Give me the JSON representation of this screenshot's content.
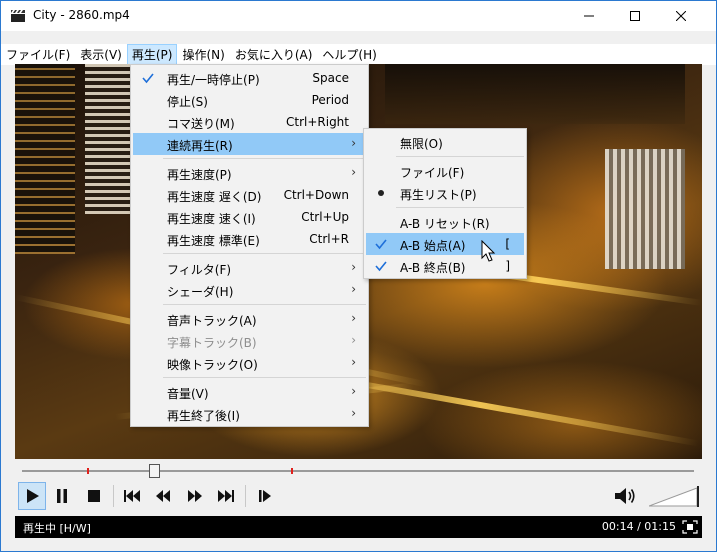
{
  "window": {
    "title": "City - 2860.mp4",
    "icon": "clapperboard-icon"
  },
  "menubar": [
    {
      "label": "ファイル(F)"
    },
    {
      "label": "表示(V)"
    },
    {
      "label": "再生(P)"
    },
    {
      "label": "操作(N)"
    },
    {
      "label": "お気に入り(A)"
    },
    {
      "label": "ヘルプ(H)"
    }
  ],
  "play_menu": {
    "items": [
      {
        "label": "再生/一時停止(P)",
        "shortcut": "Space",
        "checked": true
      },
      {
        "label": "停止(S)",
        "shortcut": "Period"
      },
      {
        "label": "コマ送り(M)",
        "shortcut": "Ctrl+Right"
      },
      {
        "label": "連続再生(R)",
        "submenu": true,
        "highlighted": true
      },
      {
        "label": "再生速度(P)",
        "submenu": true
      },
      {
        "label": "再生速度 遅く(D)",
        "shortcut": "Ctrl+Down"
      },
      {
        "label": "再生速度 速く(I)",
        "shortcut": "Ctrl+Up"
      },
      {
        "label": "再生速度 標準(E)",
        "shortcut": "Ctrl+R"
      },
      {
        "label": "フィルタ(F)",
        "submenu": true
      },
      {
        "label": "シェーダ(H)",
        "submenu": true
      },
      {
        "label": "音声トラック(A)",
        "submenu": true
      },
      {
        "label": "字幕トラック(B)",
        "submenu": true,
        "disabled": true
      },
      {
        "label": "映像トラック(O)",
        "submenu": true
      },
      {
        "label": "音量(V)",
        "submenu": true
      },
      {
        "label": "再生終了後(I)",
        "submenu": true
      }
    ]
  },
  "repeat_menu": {
    "items": [
      {
        "label": "無限(O)"
      },
      {
        "label": "ファイル(F)"
      },
      {
        "label": "再生リスト(P)",
        "radio": true
      },
      {
        "label": "A-B リセット(R)"
      },
      {
        "label": "A-B 始点(A)",
        "shortcut": "[",
        "checked": true,
        "highlighted": true
      },
      {
        "label": "A-B 終点(B)",
        "shortcut": "]",
        "checked": true
      }
    ]
  },
  "player": {
    "progress": 0.195,
    "ab_start": 0.1,
    "ab_end": 0.4,
    "volume": 0.9
  },
  "status": {
    "state": "再生中 [H/W]",
    "time": "00:14 / 01:15"
  },
  "colors": {
    "menu_highlight": "#91c9f7",
    "menubar_active": "#cce8ff",
    "check": "#1e6fd9",
    "ab_marker": "#e0201c"
  }
}
